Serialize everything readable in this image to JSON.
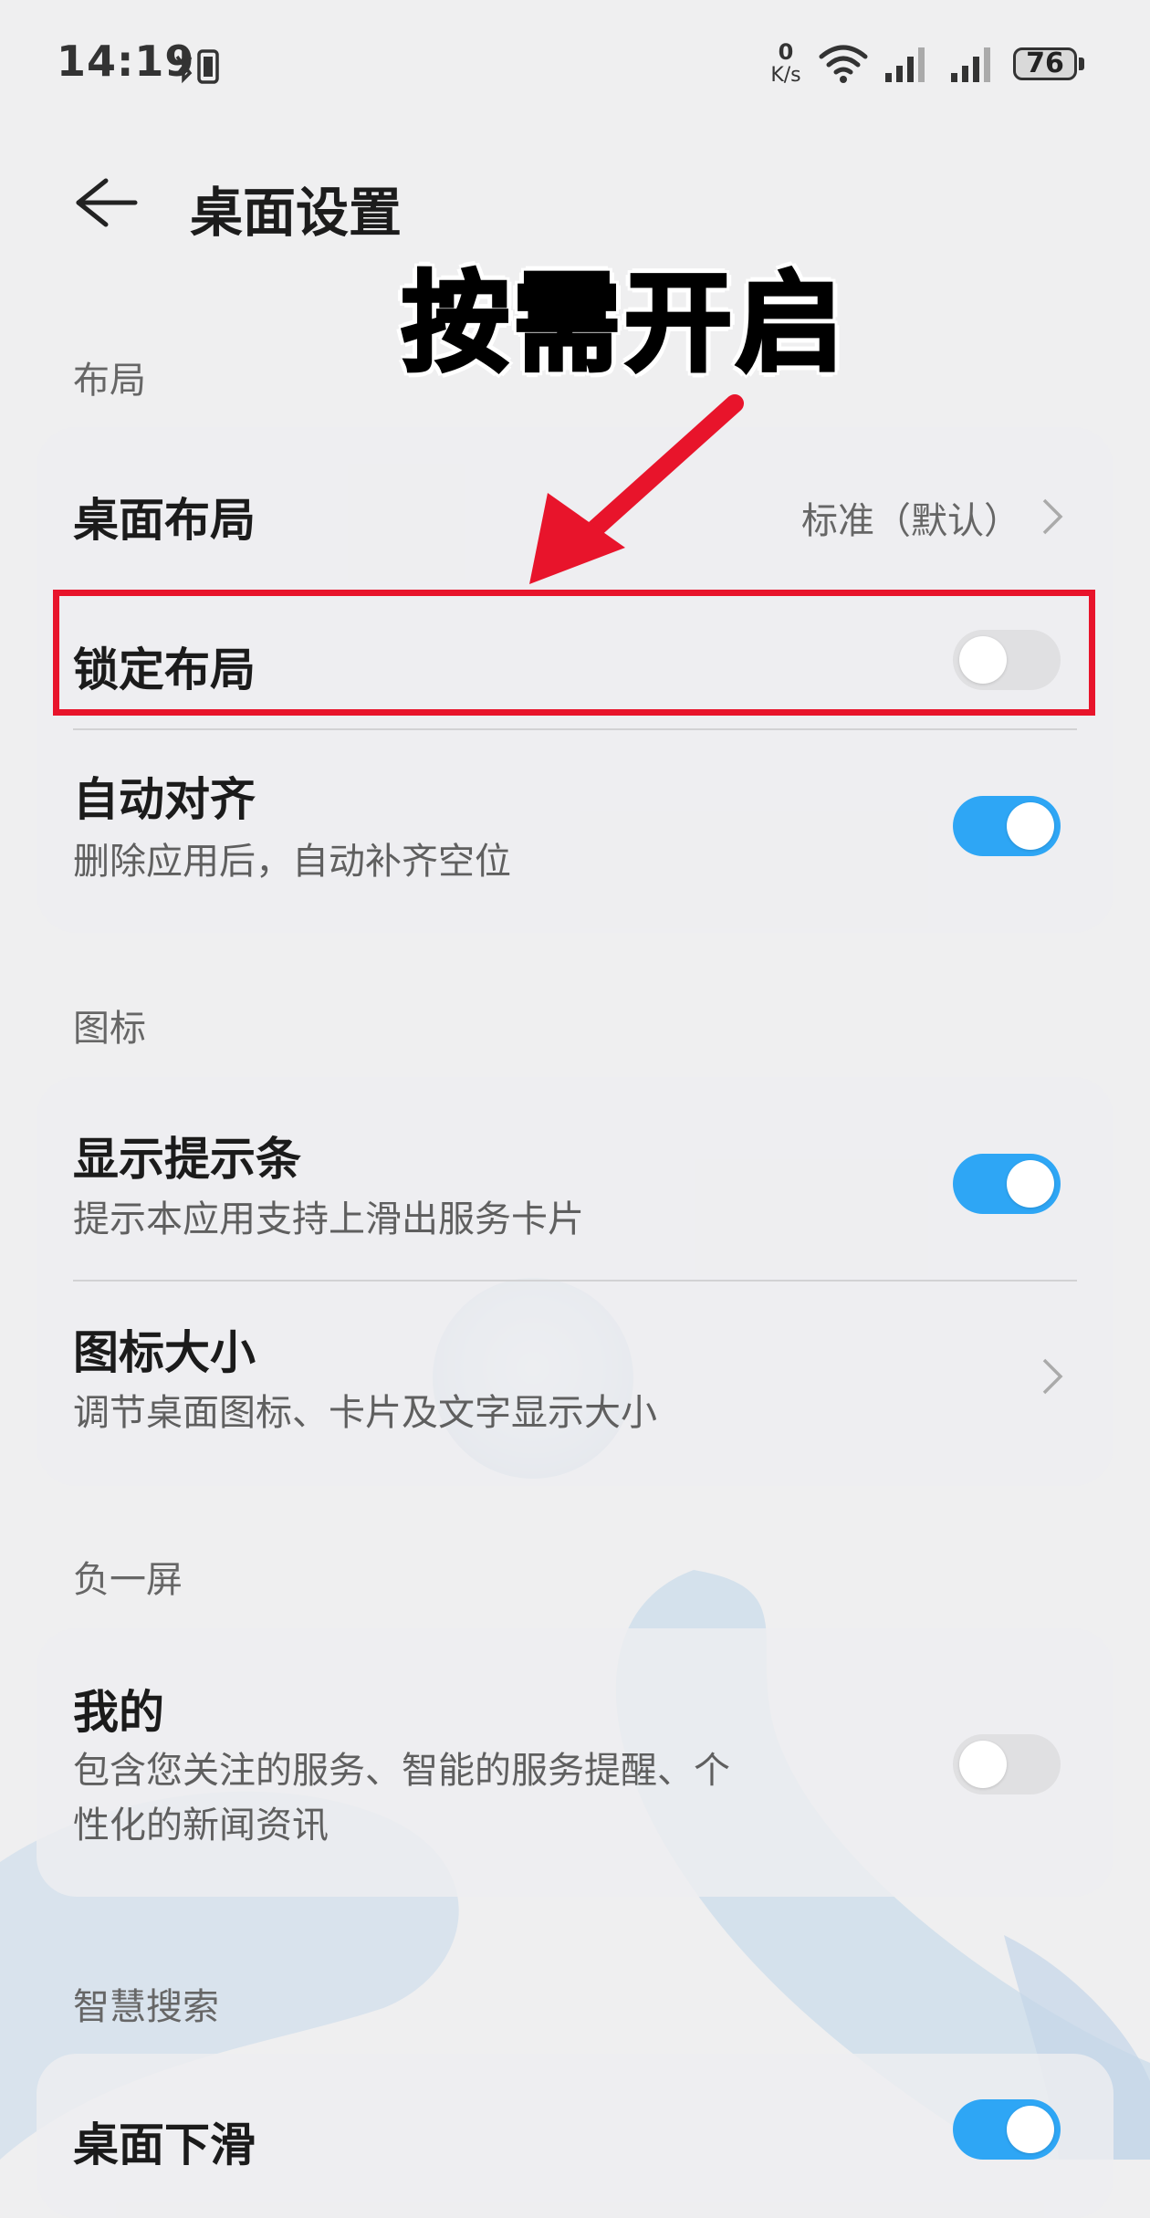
{
  "status_bar": {
    "time": "14:19",
    "net_speed_value": "0",
    "net_speed_unit": "K/s",
    "battery": "76"
  },
  "header": {
    "title": "桌面设置"
  },
  "annotation": {
    "text": "按需开启",
    "color": "#e8142b"
  },
  "sections": {
    "layout": {
      "title": "布局",
      "desktop_layout": {
        "title": "桌面布局",
        "value": "标准（默认）"
      },
      "lock_layout": {
        "title": "锁定布局",
        "enabled": false
      },
      "auto_align": {
        "title": "自动对齐",
        "subtitle": "删除应用后，自动补齐空位",
        "enabled": true
      }
    },
    "icons": {
      "title": "图标",
      "show_hint_bar": {
        "title": "显示提示条",
        "subtitle": "提示本应用支持上滑出服务卡片",
        "enabled": true
      },
      "icon_size": {
        "title": "图标大小",
        "subtitle": "调节桌面图标、卡片及文字显示大小"
      }
    },
    "minus_one": {
      "title": "负一屏",
      "mine": {
        "title": "我的",
        "subtitle_line1": "包含您关注的服务、智能的服务提醒、个",
        "subtitle_line2": "性化的新闻资讯",
        "enabled": false
      }
    },
    "smart_search": {
      "title": "智慧搜索",
      "swipe_down": {
        "title": "桌面下滑",
        "enabled": true
      }
    }
  },
  "colors": {
    "toggle_on": "#2ea6f5",
    "toggle_off": "#e0e0e2",
    "highlight_box": "#e8142b"
  }
}
